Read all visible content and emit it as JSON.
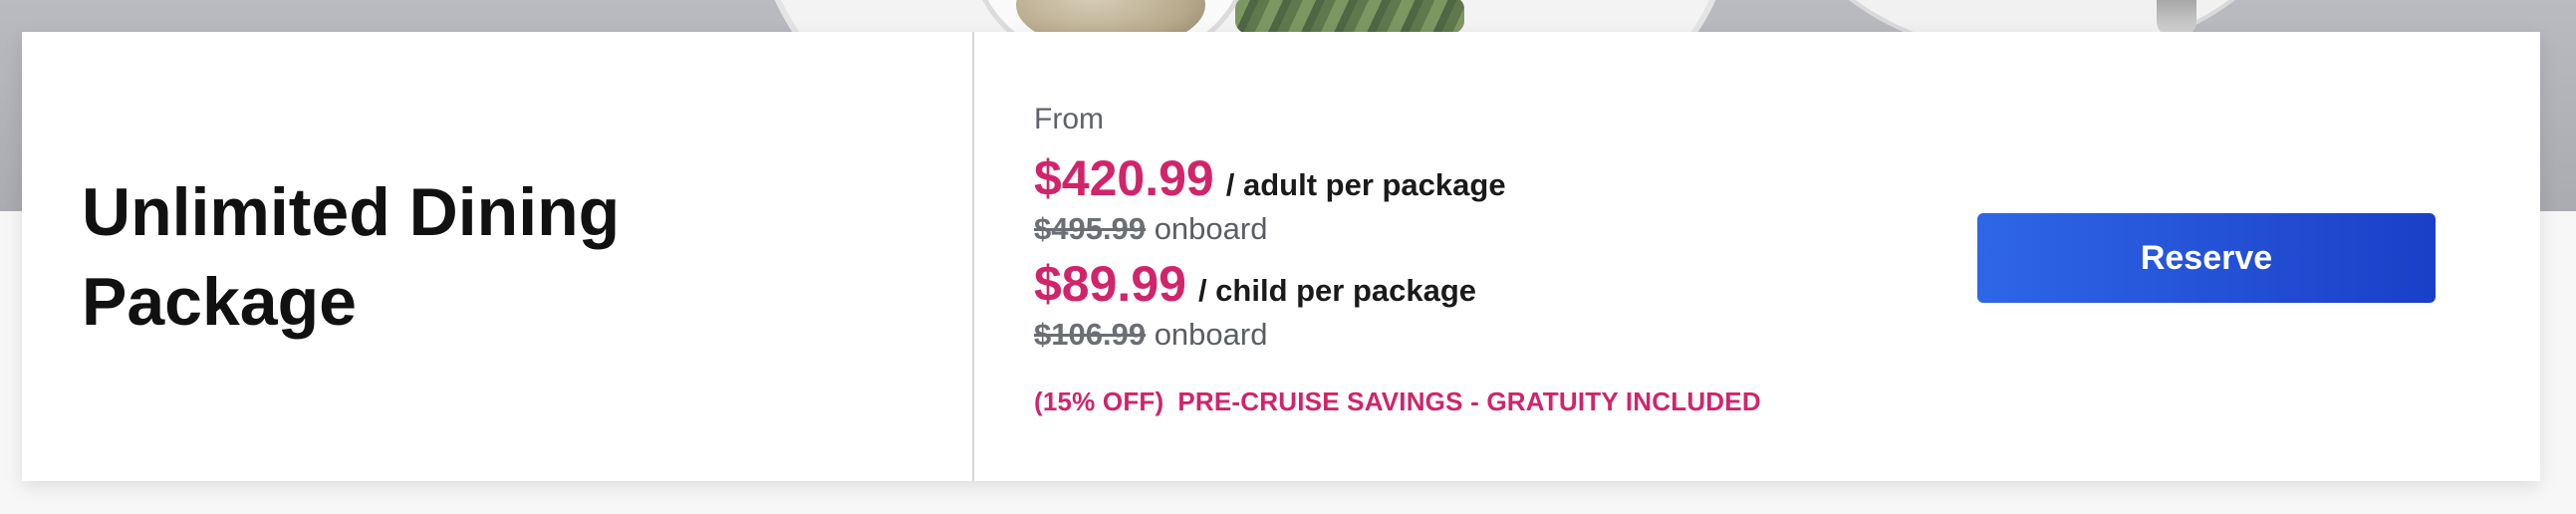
{
  "package": {
    "title": "Unlimited Dining Package"
  },
  "pricing": {
    "from_label": "From",
    "adult": {
      "price": "$420.99",
      "per_label": "/ adult per package",
      "original_price": "$495.99",
      "onboard_label": "onboard"
    },
    "child": {
      "price": "$89.99",
      "per_label": "/ child per package",
      "original_price": "$106.99",
      "onboard_label": "onboard"
    },
    "discount_label": "(15% OFF)",
    "savings_label": "PRE-CRUISE SAVINGS - GRATUITY INCLUDED"
  },
  "actions": {
    "reserve_label": "Reserve"
  },
  "colors": {
    "accent_price": "#d0246b",
    "button": "#2a55dc"
  }
}
